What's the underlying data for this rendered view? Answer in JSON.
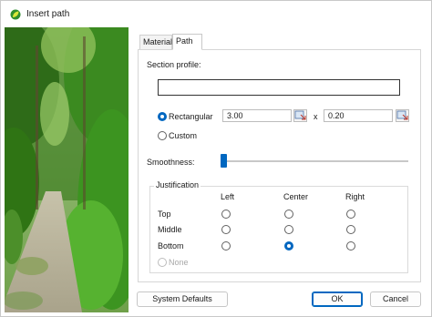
{
  "window": {
    "title": "Insert path"
  },
  "tabs": [
    {
      "label": "Material",
      "active": false
    },
    {
      "label": "Path",
      "active": true
    }
  ],
  "section_profile": {
    "label": "Section profile:",
    "value": ""
  },
  "shape": {
    "rectangular_label": "Rectangular",
    "rectangular_selected": true,
    "width_value": "3.00",
    "x_separator": "x",
    "height_value": "0.20",
    "custom_label": "Custom",
    "custom_selected": false
  },
  "smoothness": {
    "label": "Smoothness:",
    "level_fraction": 0.0
  },
  "justification": {
    "title": "Justification",
    "columns": [
      "Left",
      "Center",
      "Right"
    ],
    "rows": [
      "Top",
      "Middle",
      "Bottom"
    ],
    "selected": {
      "row": "Bottom",
      "column": "Center"
    },
    "none_label": "None",
    "none_enabled": false
  },
  "buttons": {
    "system_defaults": "System Defaults",
    "ok": "OK",
    "cancel": "Cancel"
  },
  "colors": {
    "accent": "#0067c0",
    "window_bg": "#ffffff",
    "border": "#c9c9c9"
  },
  "icons": {
    "app": "leaf-app-icon",
    "pick": "pick-from-model-icon"
  }
}
